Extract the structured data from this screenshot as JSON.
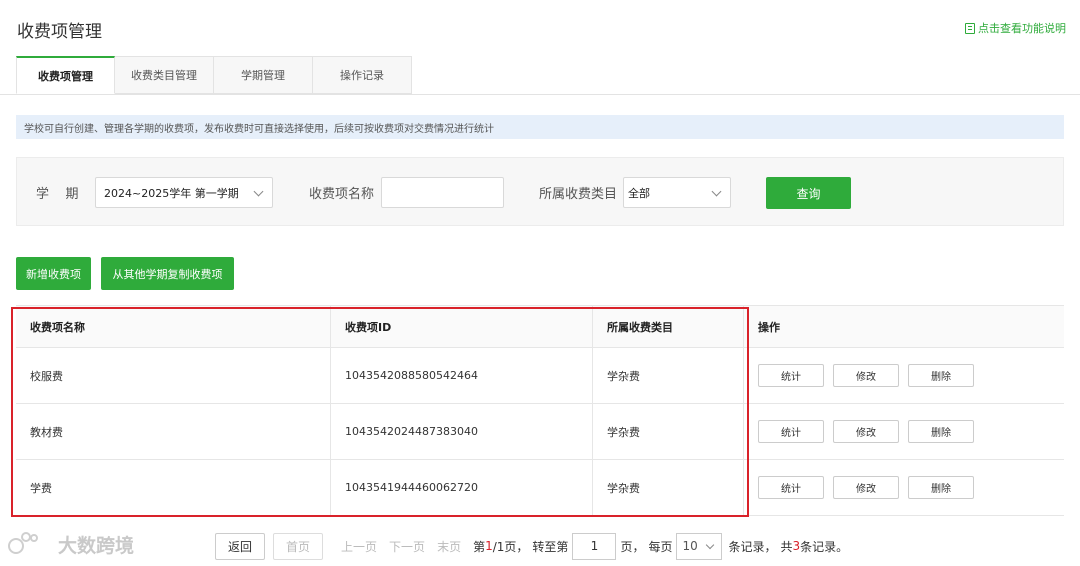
{
  "page": {
    "title": "收费项管理",
    "help_link": "点击查看功能说明"
  },
  "tabs": [
    {
      "label": "收费项管理",
      "active": true
    },
    {
      "label": "收费类目管理",
      "active": false
    },
    {
      "label": "学期管理",
      "active": false
    },
    {
      "label": "操作记录",
      "active": false
    }
  ],
  "notice": "学校可自行创建、管理各学期的收费项，发布收费时可直接选择使用，后续可按收费项对交费情况进行统计",
  "filter": {
    "term_label": "学    期",
    "term_value": "2024~2025学年 第一学期",
    "name_label": "收费项名称",
    "name_value": "",
    "category_label": "所属收费类目",
    "category_value": "全部",
    "query_button": "查询"
  },
  "actions": {
    "add": "新增收费项",
    "copy": "从其他学期复制收费项"
  },
  "table": {
    "headers": [
      "收费项名称",
      "收费项ID",
      "所属收费类目",
      "操作"
    ],
    "rows": [
      {
        "name": "校服费",
        "id": "1043542088580542464",
        "category": "学杂费"
      },
      {
        "name": "教材费",
        "id": "1043542024487383040",
        "category": "学杂费"
      },
      {
        "name": "学费",
        "id": "1043541944460062720",
        "category": "学杂费"
      }
    ],
    "ops": {
      "stats": "统计",
      "edit": "修改",
      "delete": "删除"
    }
  },
  "pagination": {
    "back": "返回",
    "first": "首页",
    "prev": "上一页",
    "next": "下一页",
    "last": "末页",
    "page_prefix": "第",
    "current_page": "1",
    "page_mid": "/1页，",
    "goto_label": "转至第",
    "goto_value": "1",
    "page_unit": "页，",
    "per_page_label": "每页",
    "per_page_value": "10",
    "records_suffix": "条记录，",
    "total_prefix": "共",
    "total_count": "3",
    "total_suffix": "条记录。"
  },
  "watermark": "大数跨境",
  "colors": {
    "accent": "#2fab3b",
    "highlight": "#d9222a",
    "notice_bg": "#e6effa"
  }
}
